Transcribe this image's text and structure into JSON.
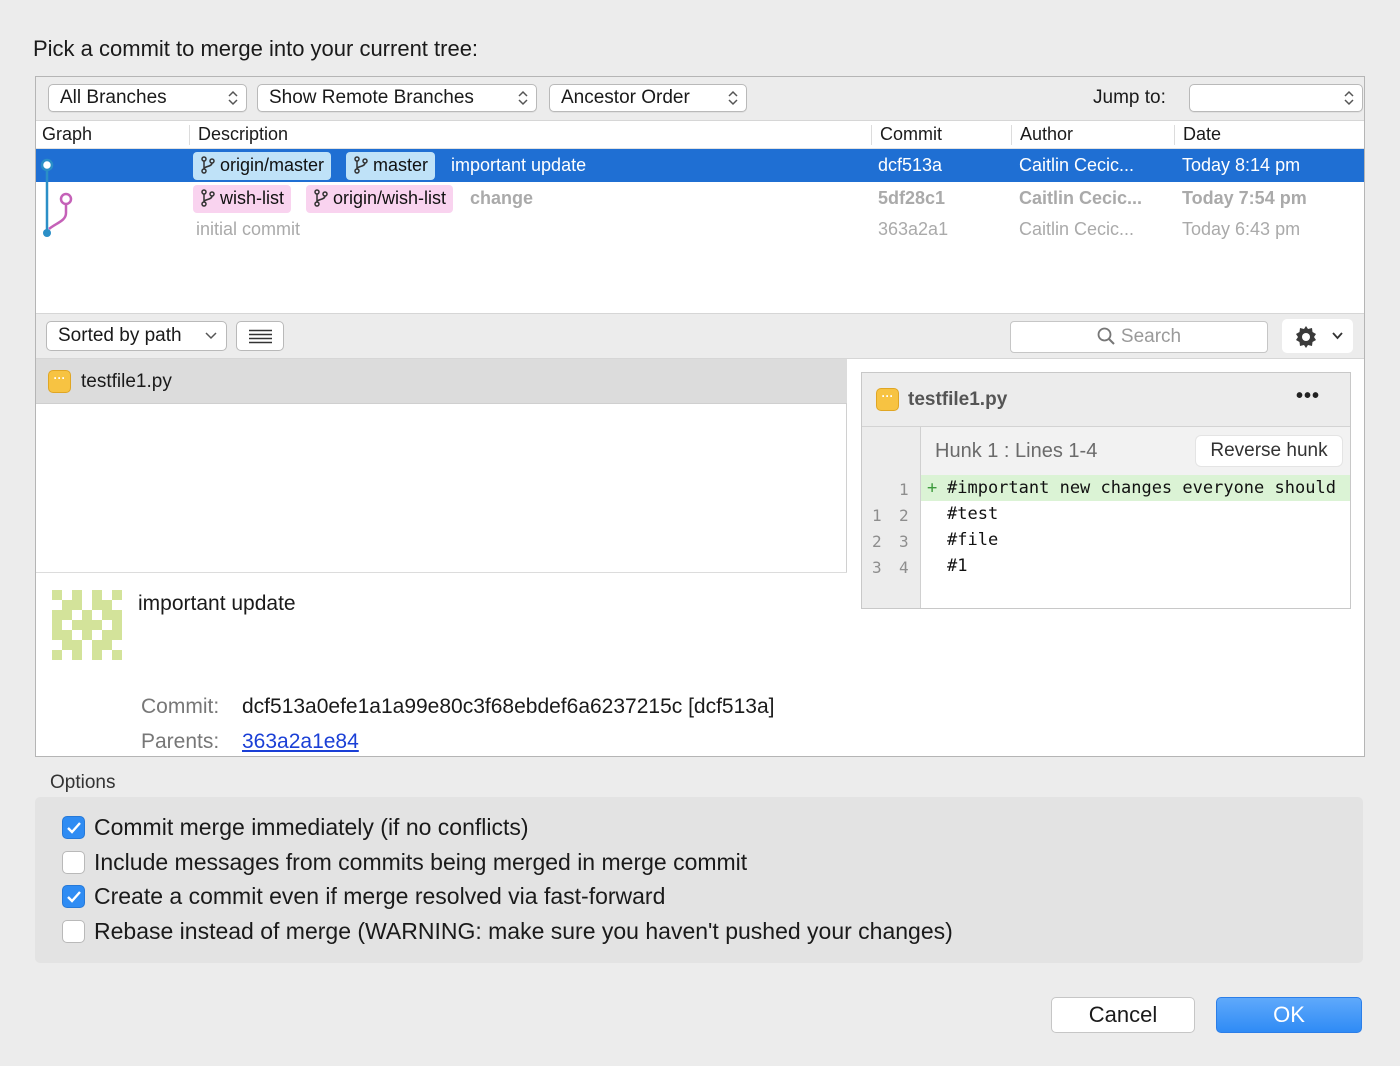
{
  "dialog": {
    "prompt": "Pick a commit to merge into your current tree:"
  },
  "toolbar": {
    "branches_select": "All Branches",
    "remote_select": "Show Remote Branches",
    "order_select": "Ancestor Order",
    "jump_label": "Jump to:",
    "jump_value": ""
  },
  "columns": {
    "graph": "Graph",
    "description": "Description",
    "commit": "Commit",
    "author": "Author",
    "date": "Date"
  },
  "commits": [
    {
      "tags": [
        "origin/master",
        "master"
      ],
      "message": "important update",
      "hash": "dcf513a",
      "author": "Caitlin Cecic...",
      "date": "Today 8:14 pm"
    },
    {
      "tags": [
        "wish-list",
        "origin/wish-list"
      ],
      "message": "change",
      "hash": "5df28c1",
      "author": "Caitlin Cecic...",
      "date": "Today 7:54 pm"
    },
    {
      "tags": [],
      "message": "initial commit",
      "hash": "363a2a1",
      "author": "Caitlin Cecic...",
      "date": "Today 6:43 pm"
    }
  ],
  "files_toolbar": {
    "sort_label": "Sorted by path",
    "search_placeholder": "Search"
  },
  "files": [
    {
      "name": "testfile1.py",
      "icon": "ellipsis-file-icon"
    }
  ],
  "commit_detail": {
    "subject": "important update",
    "commit_label": "Commit:",
    "commit_value": "dcf513a0efe1a1a99e80c3f68ebdef6a6237215c [dcf513a]",
    "parents_label": "Parents:",
    "parents_value": "363a2a1e84"
  },
  "diff": {
    "filename": "testfile1.py",
    "more_icon": "•••",
    "hunk_title": "Hunk 1 : Lines 1-4",
    "reverse_label": "Reverse hunk",
    "lines": [
      {
        "old": "",
        "new": "1",
        "prefix": "+",
        "text": "#important new changes everyone should"
      },
      {
        "old": "1",
        "new": "2",
        "prefix": "",
        "text": "#test"
      },
      {
        "old": "2",
        "new": "3",
        "prefix": "",
        "text": "#file"
      },
      {
        "old": "3",
        "new": "4",
        "prefix": "",
        "text": "#1"
      }
    ]
  },
  "options": {
    "label": "Options",
    "items": [
      {
        "label": "Commit merge immediately (if no conflicts)",
        "checked": true
      },
      {
        "label": "Include messages from commits being merged in merge commit",
        "checked": false
      },
      {
        "label": "Create a commit even if merge resolved via fast-forward",
        "checked": true
      },
      {
        "label": "Rebase instead of merge (WARNING: make sure you haven't pushed your changes)",
        "checked": false
      }
    ]
  },
  "buttons": {
    "cancel": "Cancel",
    "ok": "OK"
  },
  "colors": {
    "selection": "#1f6fd3",
    "accent": "#2f8cf3",
    "graph_blue": "#2b8fc7",
    "graph_pink": "#c561b8",
    "tag_blue": "#bfe2f8",
    "tag_pink": "#f9d3ef",
    "added_line": "#dbf3d5"
  }
}
